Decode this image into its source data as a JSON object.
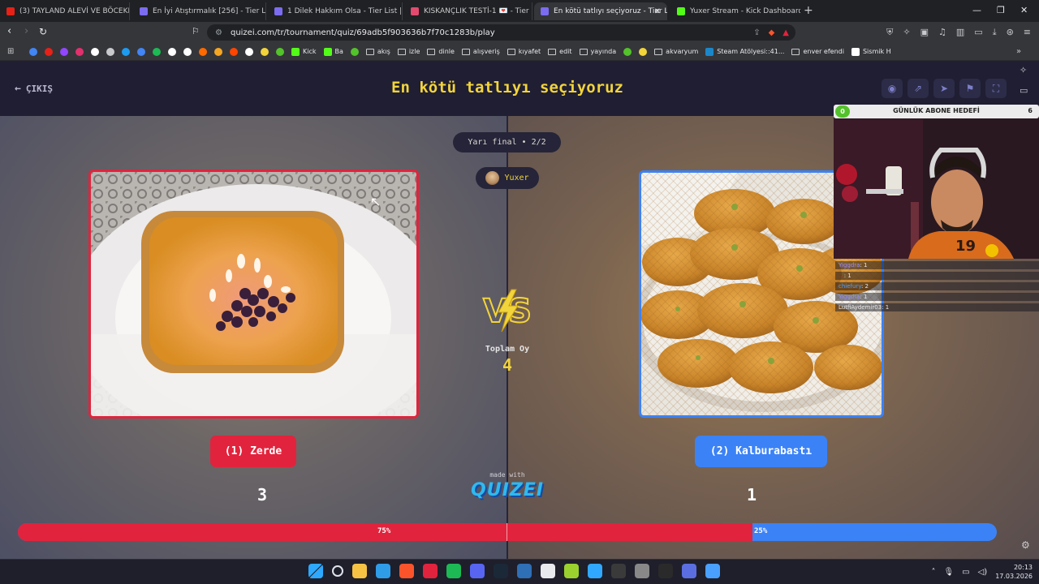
{
  "browser": {
    "tabs": [
      {
        "title": "(3) TAYLAND ALEVİ VE BÖCEKLİ SOK",
        "color": "#e62117"
      },
      {
        "title": "En İyi Atıştırmalık [256] - Tier List | Kö",
        "color": "#7b6cf0"
      },
      {
        "title": "1 Dilek Hakkım Olsa - Tier List | Kör S",
        "color": "#7b6cf0"
      },
      {
        "title": "KISKANÇLIK TESTİ-1 💌 - Tier List",
        "color": "#e24b6f"
      },
      {
        "title": "En kötü tatlıyı seçiyoruz - Tier Li",
        "color": "#7b6cf0",
        "active": true
      },
      {
        "title": "Yuxer Stream - Kick Dashboard",
        "color": "#53fc18"
      }
    ],
    "new_tab": "+",
    "window_controls": {
      "minimize": "—",
      "restore": "❐",
      "close": "✕"
    },
    "url": "quizei.com/tr/tournament/quiz/69adb5f903636b7f70c1283b/play",
    "bookmarks": [
      {
        "label": "",
        "type": "icon",
        "color": "#4285f4"
      },
      {
        "label": "",
        "type": "icon",
        "color": "#e62117"
      },
      {
        "label": "",
        "type": "icon",
        "color": "#9146ff"
      },
      {
        "label": "",
        "type": "icon",
        "color": "#e1306c"
      },
      {
        "label": "",
        "type": "icon",
        "color": "#ffffff"
      },
      {
        "label": "",
        "type": "icon",
        "color": "#c9cacc"
      },
      {
        "label": "",
        "type": "icon",
        "color": "#1d9bf0"
      },
      {
        "label": "",
        "type": "icon",
        "color": "#4285f4"
      },
      {
        "label": "",
        "type": "icon",
        "color": "#1db954"
      },
      {
        "label": "",
        "type": "icon",
        "color": "#ffffff"
      },
      {
        "label": "",
        "type": "icon",
        "color": "#ffffff"
      },
      {
        "label": "",
        "type": "icon",
        "color": "#ff6a00"
      },
      {
        "label": "",
        "type": "icon",
        "color": "#f5a623"
      },
      {
        "label": "",
        "type": "icon",
        "color": "#ff4500"
      },
      {
        "label": "",
        "type": "icon",
        "color": "#ffffff"
      },
      {
        "label": "",
        "type": "icon",
        "color": "#f2d43b"
      },
      {
        "label": "",
        "type": "icon",
        "color": "#53c22b"
      },
      {
        "label": "Kick",
        "type": "site",
        "color": "#53fc18"
      },
      {
        "label": "Ba",
        "type": "site",
        "color": "#53fc18"
      },
      {
        "label": "",
        "type": "icon",
        "color": "#53c22b"
      },
      {
        "label": "akış",
        "type": "folder"
      },
      {
        "label": "izle",
        "type": "folder"
      },
      {
        "label": "dinle",
        "type": "folder"
      },
      {
        "label": "alışveriş",
        "type": "folder"
      },
      {
        "label": "kıyafet",
        "type": "folder"
      },
      {
        "label": "edit",
        "type": "folder"
      },
      {
        "label": "yayında",
        "type": "folder"
      },
      {
        "label": "",
        "type": "icon",
        "color": "#53c22b"
      },
      {
        "label": "",
        "type": "icon",
        "color": "#f2d43b"
      },
      {
        "label": "akvaryum",
        "type": "folder"
      },
      {
        "label": "Steam Atölyesi::41...",
        "type": "site",
        "color": "#1b87c9"
      },
      {
        "label": "enver efendi",
        "type": "folder"
      },
      {
        "label": "Sismik H",
        "type": "site",
        "color": "#ffffff"
      }
    ]
  },
  "quiz": {
    "exit_label": "ÇIKIŞ",
    "title": "En kötü tatlıyı seçiyoruz",
    "round_label": "Yarı final • 2/2",
    "user_name": "Yuxer",
    "total_votes_label": "Toplam Oy",
    "total_votes": "4",
    "vs_label": "VS",
    "left": {
      "label": "(1) Zerde",
      "votes": "3",
      "percent_label": "75%",
      "percent": 75
    },
    "right": {
      "label": "(2) Kalburabastı",
      "votes": "1",
      "percent_label": "25%",
      "percent": 25
    },
    "made_with": "made with",
    "brand": "QUIZEI",
    "accent_left": "#e2233d",
    "accent_right": "#3b82f6",
    "title_color": "#f2d43b"
  },
  "stream": {
    "goal_title": "GÜNLÜK ABONE HEDEFİ",
    "goal_current": "0",
    "goal_target": "6",
    "chat": [
      {
        "user": "Yiggdra",
        "text": ": 1"
      },
      {
        "user": "...",
        "text": ": 1"
      },
      {
        "user": "chiefury",
        "text": ": 2"
      },
      {
        "user": "Yiggdra",
        "text": ": 1"
      },
      {
        "user": "LutfiAydemir03",
        "text": ": 1"
      }
    ]
  },
  "taskbar": {
    "time": "20:13",
    "date": "17.03.2026",
    "apps": [
      "windows-start",
      "search",
      "file-explorer",
      "edge",
      "brave",
      "opera",
      "spotify",
      "discord",
      "steam",
      "calculator",
      "terminal",
      "xbox",
      "photoshop",
      "obs",
      "app",
      "epic-games",
      "app2",
      "app3"
    ]
  }
}
